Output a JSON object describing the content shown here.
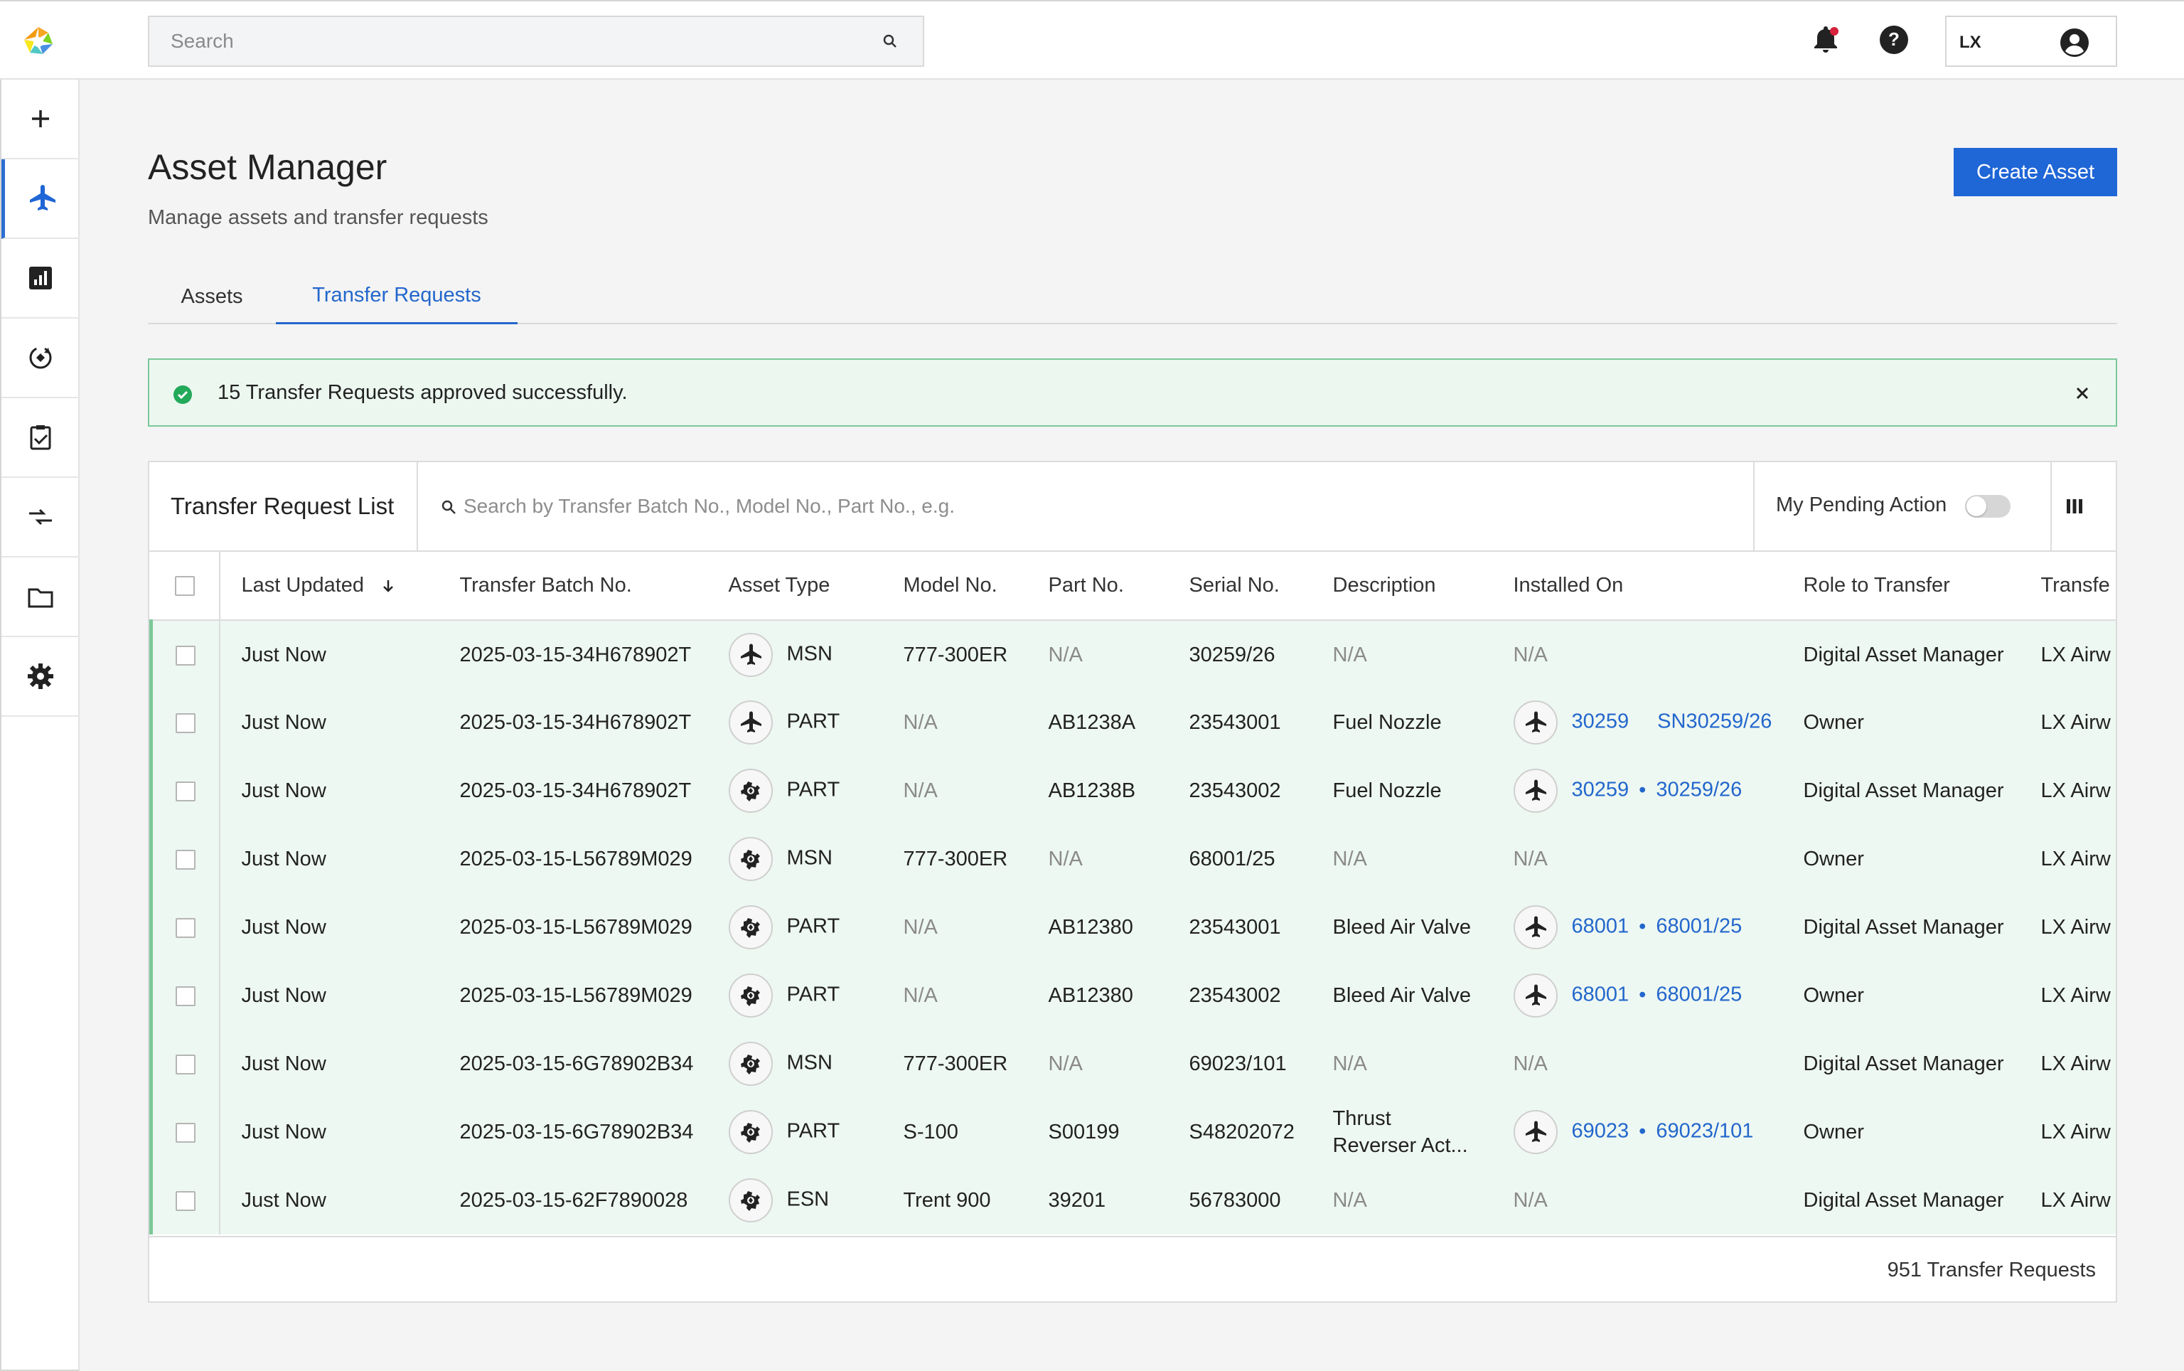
{
  "header": {
    "search_placeholder": "Search",
    "user_initials": "LX",
    "icons": [
      "bell-icon",
      "help-icon",
      "account-icon"
    ]
  },
  "sidebar": {
    "items": [
      {
        "icon": "plus-icon"
      },
      {
        "icon": "airplane-icon",
        "active": true
      },
      {
        "icon": "reports-icon"
      },
      {
        "icon": "sync-icon"
      },
      {
        "icon": "clipboard-check-icon"
      },
      {
        "icon": "transfer-icon"
      },
      {
        "icon": "folder-icon"
      },
      {
        "icon": "settings-icon"
      }
    ]
  },
  "page": {
    "title": "Asset Manager",
    "subtitle": "Manage assets and transfer requests",
    "create_button": "Create Asset"
  },
  "tabs": [
    {
      "label": "Assets"
    },
    {
      "label": "Transfer Requests",
      "active": true
    }
  ],
  "alert": {
    "message": "15 Transfer Requests approved successfully."
  },
  "list": {
    "title": "Transfer Request List",
    "search_placeholder": "Search by Transfer Batch No., Model No., Part No., e.g.",
    "pending_label": "My Pending Action",
    "pending_enabled": false
  },
  "table": {
    "columns": [
      "Last Updated",
      "Transfer Batch No.",
      "Asset Type",
      "Model No.",
      "Part No.",
      "Serial No.",
      "Description",
      "Installed On",
      "Role to Transfer",
      "Transfe"
    ],
    "rows": [
      {
        "updated": "Just Now",
        "batch": "2025-03-15-34H678902T",
        "type_icon": "airplane-icon",
        "type": "MSN",
        "model": "777-300ER",
        "part": "N/A",
        "serial": "30259/26",
        "desc": "N/A",
        "installed_a": "",
        "installed_b": "",
        "installed_sep": "",
        "role": "Digital Asset Manager",
        "transfer": "LX Airw"
      },
      {
        "updated": "Just Now",
        "batch": "2025-03-15-34H678902T",
        "type_icon": "airplane-icon",
        "type": "PART",
        "model": "N/A",
        "part": "AB1238A",
        "serial": "23543001",
        "desc": "Fuel Nozzle",
        "installed_a": "30259",
        "installed_b": "SN30259/26",
        "installed_sep": "",
        "role": "Owner",
        "transfer": "LX Airw"
      },
      {
        "updated": "Just Now",
        "batch": "2025-03-15-34H678902T",
        "type_icon": "engine-icon",
        "type": "PART",
        "model": "N/A",
        "part": "AB1238B",
        "serial": "23543002",
        "desc": "Fuel Nozzle",
        "installed_a": "30259",
        "installed_b": "30259/26",
        "installed_sep": "•",
        "role": "Digital Asset Manager",
        "transfer": "LX Airw"
      },
      {
        "updated": "Just Now",
        "batch": "2025-03-15-L56789M029",
        "type_icon": "engine-icon",
        "type": "MSN",
        "model": "777-300ER",
        "part": "N/A",
        "serial": "68001/25",
        "desc": "N/A",
        "installed_a": "",
        "installed_b": "",
        "installed_sep": "",
        "role": "Owner",
        "transfer": "LX Airw"
      },
      {
        "updated": "Just Now",
        "batch": "2025-03-15-L56789M029",
        "type_icon": "engine-icon",
        "type": "PART",
        "model": "N/A",
        "part": "AB12380",
        "serial": "23543001",
        "desc": "Bleed Air Valve",
        "installed_a": "68001",
        "installed_b": "68001/25",
        "installed_sep": "•",
        "role": "Digital Asset Manager",
        "transfer": "LX Airw"
      },
      {
        "updated": "Just Now",
        "batch": "2025-03-15-L56789M029",
        "type_icon": "engine-icon",
        "type": "PART",
        "model": "N/A",
        "part": "AB12380",
        "serial": "23543002",
        "desc": "Bleed Air Valve",
        "installed_a": "68001",
        "installed_b": "68001/25",
        "installed_sep": "•",
        "role": "Owner",
        "transfer": "LX Airw"
      },
      {
        "updated": "Just Now",
        "batch": "2025-03-15-6G78902B34",
        "type_icon": "engine-icon",
        "type": "MSN",
        "model": "777-300ER",
        "part": "N/A",
        "serial": "69023/101",
        "desc": "N/A",
        "installed_a": "",
        "installed_b": "",
        "installed_sep": "",
        "role": "Digital Asset Manager",
        "transfer": "LX Airw"
      },
      {
        "updated": "Just Now",
        "batch": "2025-03-15-6G78902B34",
        "type_icon": "engine-icon",
        "type": "PART",
        "model": "S-100",
        "part": "S00199",
        "serial": "S48202072",
        "desc": "Thrust Reverser Act...",
        "installed_a": "69023",
        "installed_b": "69023/101",
        "installed_sep": "•",
        "role": "Owner",
        "transfer": "LX Airw"
      },
      {
        "updated": "Just Now",
        "batch": "2025-03-15-62F7890028",
        "type_icon": "engine-icon",
        "type": "ESN",
        "model": "Trent 900",
        "part": "39201",
        "serial": "56783000",
        "desc": "N/A",
        "installed_a": "",
        "installed_b": "",
        "installed_sep": "",
        "role": "Digital Asset Manager",
        "transfer": "LX Airw"
      }
    ],
    "na_label": "N/A",
    "footer_count": "951 Transfer Requests"
  },
  "colors": {
    "accent": "#1f66d6",
    "success_bg": "#ecf7f0",
    "success_border": "#7cc89a",
    "notification": "#d6223b"
  }
}
